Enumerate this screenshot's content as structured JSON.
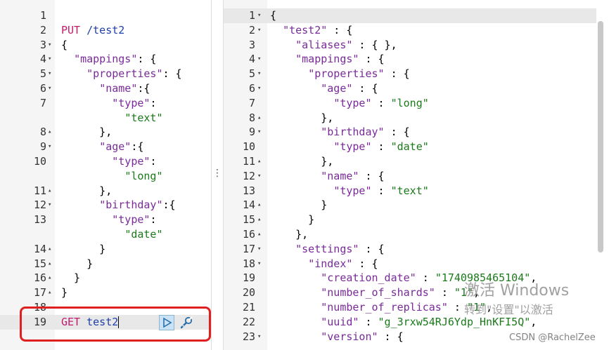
{
  "request_editor": {
    "lines": [
      {
        "n": "1",
        "fold": "",
        "text": ""
      },
      {
        "n": "2",
        "fold": "",
        "text": "PUT /test2"
      },
      {
        "n": "3",
        "fold": "▾",
        "text": "{"
      },
      {
        "n": "4",
        "fold": "▾",
        "text": "  \"mappings\": {"
      },
      {
        "n": "5",
        "fold": "▾",
        "text": "    \"properties\": {"
      },
      {
        "n": "6",
        "fold": "▾",
        "text": "      \"name\":{"
      },
      {
        "n": "7",
        "fold": "",
        "text": "        \"type\":"
      },
      {
        "n": "",
        "fold": "",
        "text": "          \"text\""
      },
      {
        "n": "8",
        "fold": "▴",
        "text": "      },"
      },
      {
        "n": "9",
        "fold": "▾",
        "text": "      \"age\":{"
      },
      {
        "n": "10",
        "fold": "",
        "text": "        \"type\":"
      },
      {
        "n": "",
        "fold": "",
        "text": "          \"long\""
      },
      {
        "n": "11",
        "fold": "▴",
        "text": "      },"
      },
      {
        "n": "12",
        "fold": "▾",
        "text": "      \"birthday\":{"
      },
      {
        "n": "13",
        "fold": "",
        "text": "        \"type\":"
      },
      {
        "n": "",
        "fold": "",
        "text": "          \"date\""
      },
      {
        "n": "14",
        "fold": "▴",
        "text": "      }"
      },
      {
        "n": "15",
        "fold": "▴",
        "text": "    }"
      },
      {
        "n": "16",
        "fold": "▴",
        "text": "  }"
      },
      {
        "n": "17",
        "fold": "▴",
        "text": "}"
      },
      {
        "n": "18",
        "fold": "",
        "text": ""
      },
      {
        "n": "19",
        "fold": "",
        "text": "GET test2"
      }
    ]
  },
  "response_viewer": {
    "lines": [
      {
        "n": "1",
        "fold": "▾",
        "text": "{"
      },
      {
        "n": "2",
        "fold": "▾",
        "text": "  \"test2\" : {"
      },
      {
        "n": "3",
        "fold": "",
        "text": "    \"aliases\" : { },"
      },
      {
        "n": "4",
        "fold": "▾",
        "text": "    \"mappings\" : {"
      },
      {
        "n": "5",
        "fold": "▾",
        "text": "      \"properties\" : {"
      },
      {
        "n": "6",
        "fold": "▾",
        "text": "        \"age\" : {"
      },
      {
        "n": "7",
        "fold": "",
        "text": "          \"type\" : \"long\""
      },
      {
        "n": "8",
        "fold": "▴",
        "text": "        },"
      },
      {
        "n": "9",
        "fold": "▾",
        "text": "        \"birthday\" : {"
      },
      {
        "n": "10",
        "fold": "",
        "text": "          \"type\" : \"date\""
      },
      {
        "n": "11",
        "fold": "▴",
        "text": "        },"
      },
      {
        "n": "12",
        "fold": "▾",
        "text": "        \"name\" : {"
      },
      {
        "n": "13",
        "fold": "",
        "text": "          \"type\" : \"text\""
      },
      {
        "n": "14",
        "fold": "▴",
        "text": "        }"
      },
      {
        "n": "15",
        "fold": "▴",
        "text": "      }"
      },
      {
        "n": "16",
        "fold": "▴",
        "text": "    },"
      },
      {
        "n": "17",
        "fold": "▾",
        "text": "    \"settings\" : {"
      },
      {
        "n": "18",
        "fold": "▾",
        "text": "      \"index\" : {"
      },
      {
        "n": "19",
        "fold": "",
        "text": "        \"creation_date\" : \"1740985465104\","
      },
      {
        "n": "20",
        "fold": "",
        "text": "        \"number_of_shards\" : \"1\","
      },
      {
        "n": "21",
        "fold": "",
        "text": "        \"number_of_replicas\" : \"1\","
      },
      {
        "n": "22",
        "fold": "",
        "text": "        \"uuid\" : \"g_3rxw54RJ6Ydp_HnKFI5Q\","
      },
      {
        "n": "23",
        "fold": "▾",
        "text": "        \"version\" : {"
      }
    ]
  },
  "toolbar": {
    "run_icon": "play-icon",
    "settings_icon": "wrench-icon"
  },
  "overlay": {
    "watermark_line1": "激活 Windows",
    "watermark_line2": "转到\"设置\"以激活",
    "credit": "CSDN @RachelZee"
  },
  "colors": {
    "method": "#c41a6e",
    "key": "#7a2a9a",
    "string": "#1a7a1a",
    "highlight_box": "#e02020"
  }
}
